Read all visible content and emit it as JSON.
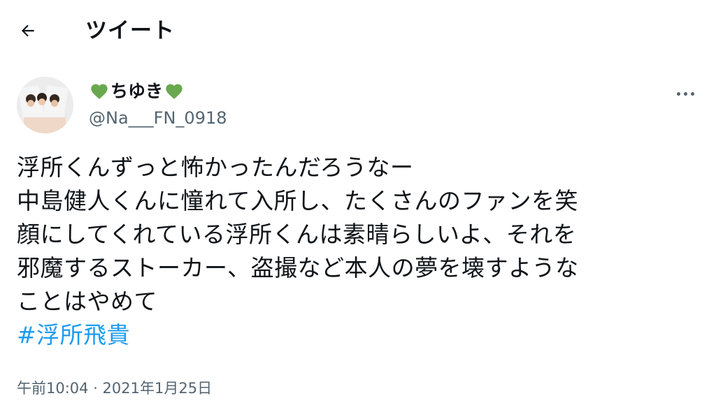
{
  "header": {
    "title": "ツイート",
    "back_icon": "arrow-left-icon"
  },
  "author": {
    "display_name": "ちゆき",
    "name_emoji": "green-heart-icon",
    "handle": "@Na___FN_0918"
  },
  "tweet": {
    "lines": [
      "浮所くんずっと怖かったんだろうなー",
      "中島健人くんに憧れて入所し、たくさんのファンを笑",
      "顔にしてくれている浮所くんは素晴らしいよ、それを",
      "邪魔するストーカー、盗撮など本人の夢を壊すような",
      "ことはやめて"
    ],
    "hashtag": "#浮所飛貴",
    "timestamp": "午前10:04 · 2021年1月25日"
  },
  "colors": {
    "link": "#1d9bf0",
    "secondary_text": "#536471",
    "heart": "#6aa84f"
  }
}
